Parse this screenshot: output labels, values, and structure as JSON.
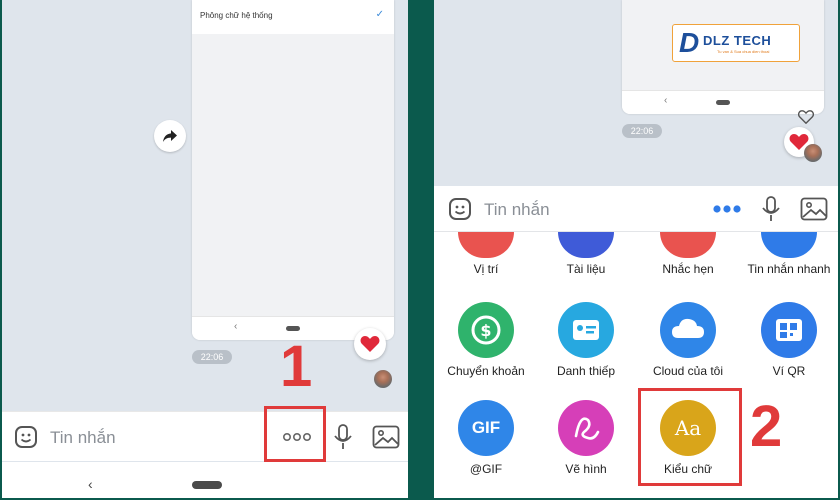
{
  "left_screen": {
    "font_option_label": "Phông chữ hệ thống",
    "timestamp": "22:06",
    "message_placeholder": "Tin nhắn",
    "step_number": "1"
  },
  "right_screen": {
    "timestamp": "22:06",
    "message_placeholder": "Tin nhắn",
    "logo_brand": "DLZ TECH",
    "logo_tagline": "Tu van & Sua chua dien thoai",
    "step_number": "2",
    "tiles_partial": [
      {
        "label": "Vị trí",
        "icon": "location-icon",
        "color": "#e9534f"
      },
      {
        "label": "Tài liệu",
        "icon": "paperclip-icon",
        "color": "#3f5bd8"
      },
      {
        "label": "Nhắc hẹn",
        "icon": "clock-icon",
        "color": "#e9534f"
      },
      {
        "label": "Tin nhắn nhanh",
        "icon": "quick-message-icon",
        "color": "#2f7be8"
      }
    ],
    "tiles": [
      {
        "label": "Chuyển khoản",
        "icon": "money-transfer-icon",
        "color": "#2fb36c"
      },
      {
        "label": "Danh thiếp",
        "icon": "contact-card-icon",
        "color": "#27a8e0"
      },
      {
        "label": "Cloud của tôi",
        "icon": "cloud-icon",
        "color": "#2f86e8"
      },
      {
        "label": "Ví QR",
        "icon": "qr-wallet-icon",
        "color": "#2f7be8"
      },
      {
        "label": "@GIF",
        "icon": "gif-icon",
        "color": "#2f86e8"
      },
      {
        "label": "Vẽ hình",
        "icon": "draw-icon",
        "color": "#d63fb8"
      },
      {
        "label": "Kiểu chữ",
        "icon": "font-style-icon",
        "color": "#d9a51a"
      }
    ],
    "font_icon_text": "Aa",
    "gif_icon_text": "GIF"
  },
  "colors": {
    "accent_red": "#e03a3a",
    "divider_green": "#0b5a4d",
    "zalo_blue": "#3d8bd9"
  }
}
